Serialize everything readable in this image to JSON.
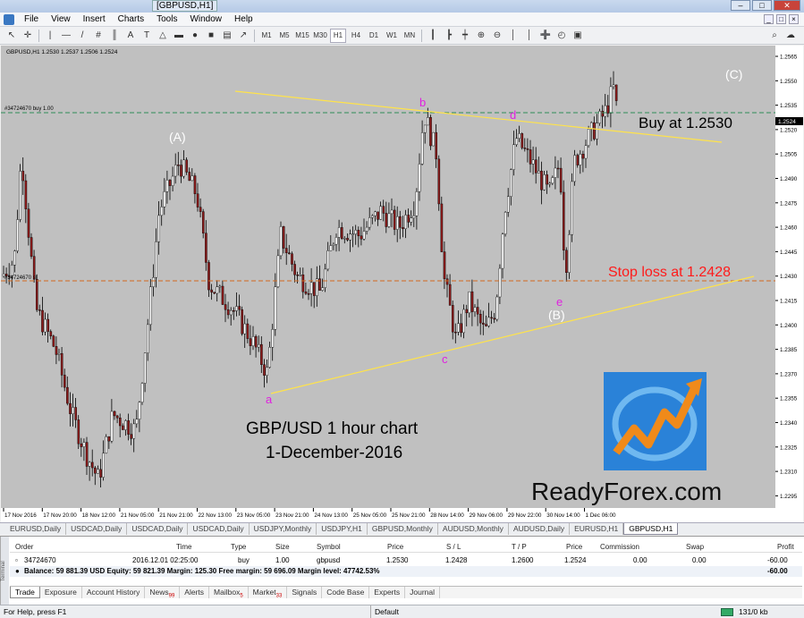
{
  "window": {
    "title": "[GBPUSD,H1]",
    "min": "–",
    "max": "□",
    "close": "✕"
  },
  "menu": [
    "File",
    "View",
    "Insert",
    "Charts",
    "Tools",
    "Window",
    "Help"
  ],
  "mdi": [
    "_",
    "□",
    "×"
  ],
  "toolbar": {
    "tools": [
      "↖",
      "✛",
      "|",
      "—",
      "/",
      "#",
      "║",
      "A",
      "T",
      "△",
      "▬",
      "●",
      "■",
      "▤",
      "↗"
    ],
    "timeframes": [
      "M1",
      "M5",
      "M15",
      "M30",
      "H1",
      "H4",
      "D1",
      "W1",
      "MN"
    ],
    "active_timeframe": "H1",
    "right": [
      "┃",
      "┣",
      "┿",
      "⊕",
      "⊖",
      "│",
      "│",
      "➕",
      "◴",
      "▣"
    ],
    "search": "⌕",
    "chat": "☁"
  },
  "chart": {
    "header": "GBPUSD,H1  1.2530 1.2537 1.2506 1.2524",
    "order_line_label": "#34724670 buy 1.00",
    "sl_line_label": "#34724670 sl",
    "buy_text": "Buy at 1.2530",
    "sl_text": "Stop loss at 1.2428",
    "title_line1": "GBP/USD 1 hour chart",
    "title_line2": "1-December-2016",
    "brand": "ReadyForex.com",
    "waves": {
      "A": "(A)",
      "B": "(B)",
      "C": "(C)",
      "a": "a",
      "b": "b",
      "c": "c",
      "d": "d",
      "e": "e"
    },
    "current_price": "1.2524",
    "price_ticks": [
      "1.2565",
      "1.2550",
      "1.2535",
      "1.2520",
      "1.2505",
      "1.2490",
      "1.2475",
      "1.2460",
      "1.2445",
      "1.2430",
      "1.2415",
      "1.2400",
      "1.2385",
      "1.2370",
      "1.2355",
      "1.2340",
      "1.2325",
      "1.2310",
      "1.2295"
    ],
    "time_ticks": [
      "17 Nov 2016",
      "17 Nov 20:00",
      "18 Nov 12:00",
      "21 Nov 05:00",
      "21 Nov 21:00",
      "22 Nov 13:00",
      "23 Nov 05:00",
      "23 Nov 21:00",
      "24 Nov 13:00",
      "25 Nov 05:00",
      "25 Nov 21:00",
      "28 Nov 14:00",
      "29 Nov 06:00",
      "29 Nov 22:00",
      "30 Nov 14:00",
      "1 Dec 06:00"
    ],
    "colors": {
      "bg": "#c0c0c0",
      "bull": "#ffffff",
      "bear": "#8b1a1a",
      "wick": "#000000",
      "buy_line": "#2e8b57",
      "sl_line": "#d2691e",
      "trend": "#ffe34a",
      "wave_small": "#e020e0",
      "wave_big": "#ffffff"
    }
  },
  "symbol_tabs": [
    "EURUSD,Daily",
    "USDCAD,Daily",
    "USDCAD,Daily",
    "USDCAD,Daily",
    "USDJPY,Monthly",
    "USDJPY,H1",
    "GBPUSD,Monthly",
    "AUDUSD,Monthly",
    "AUDUSD,Daily",
    "EURUSD,H1",
    "GBPUSD,H1"
  ],
  "active_symbol_tab": "GBPUSD,H1",
  "terminal": {
    "side_label": "Terminal",
    "headers": {
      "order": "Order",
      "time": "Time",
      "type": "Type",
      "size": "Size",
      "symbol": "Symbol",
      "price": "Price",
      "sl": "S / L",
      "tp": "T / P",
      "price2": "Price",
      "commission": "Commission",
      "swap": "Swap",
      "profit": "Profit"
    },
    "row": {
      "order": "34724670",
      "time": "2016.12.01 02:25:00",
      "type": "buy",
      "size": "1.00",
      "symbol": "gbpusd",
      "price": "1.2530",
      "sl": "1.2428",
      "tp": "1.2600",
      "price2": "1.2524",
      "commission": "0.00",
      "swap": "0.00",
      "profit": "-60.00"
    },
    "balance": "Balance: 59 881.39 USD  Equity: 59 821.39  Margin: 125.30  Free margin: 59 696.09  Margin level: 47742.53%",
    "balance_profit": "-60.00",
    "tabs": [
      {
        "label": "Trade",
        "badge": ""
      },
      {
        "label": "Exposure",
        "badge": ""
      },
      {
        "label": "Account History",
        "badge": ""
      },
      {
        "label": "News",
        "badge": "99"
      },
      {
        "label": "Alerts",
        "badge": ""
      },
      {
        "label": "Mailbox",
        "badge": "5"
      },
      {
        "label": "Market",
        "badge": "33"
      },
      {
        "label": "Signals",
        "badge": ""
      },
      {
        "label": "Code Base",
        "badge": ""
      },
      {
        "label": "Experts",
        "badge": ""
      },
      {
        "label": "Journal",
        "badge": ""
      }
    ]
  },
  "status": {
    "help": "For Help, press F1",
    "profile": "Default",
    "traffic": "131/0 kb"
  }
}
